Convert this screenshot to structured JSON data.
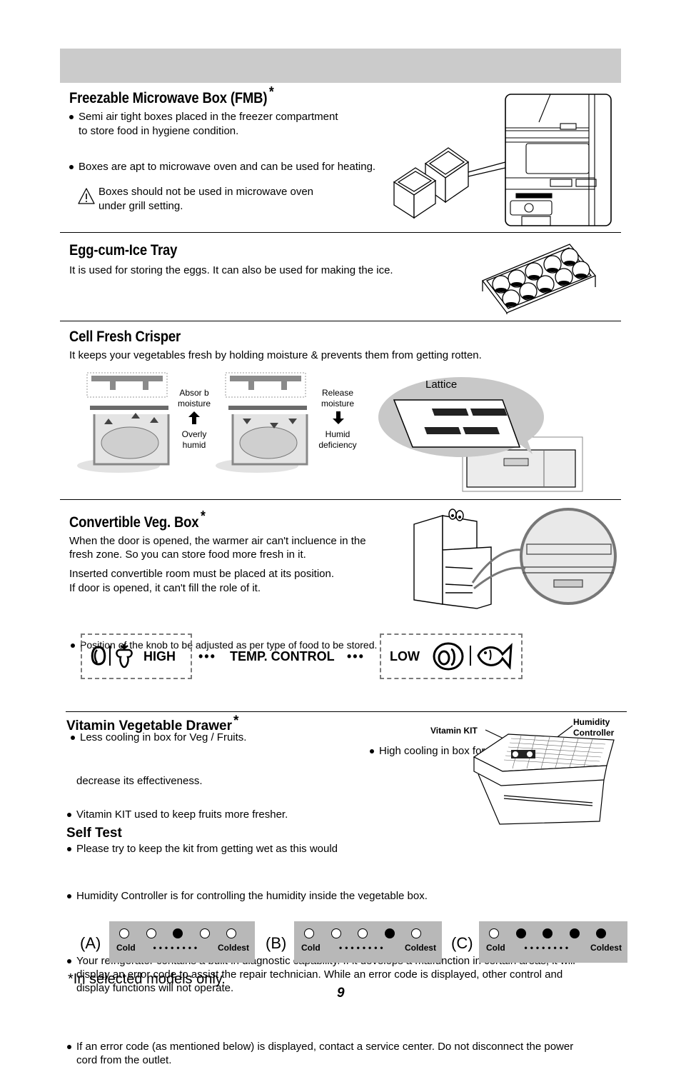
{
  "fmb": {
    "title": "Freezable Microwave Box (FMB)",
    "star": "*",
    "bullets": [
      "Semi air tight boxes placed in the freezer compartment",
      "to store food in hygiene condition.",
      "Boxes are apt to microwave oven and can be used for heating."
    ],
    "warning_line1": "Boxes should not be used in microwave oven",
    "warning_line2": "under grill setting."
  },
  "egg_tray": {
    "title": "Egg-cum-Ice Tray",
    "text": "It is used for storing the eggs. It can also be used for making the ice."
  },
  "crisper": {
    "title": "Cell Fresh Crisper",
    "text": "It keeps your vegetables fresh by holding moisture & prevents them from getting rotten.",
    "left_top1": "Absor b",
    "left_top2": "moisture",
    "left_bottom1": "Overly",
    "left_bottom2": "humid",
    "right_top1": "Release",
    "right_top2": "moisture",
    "right_bottom1": "Humid",
    "right_bottom2": "deficiency",
    "lattice_label": "Lattice"
  },
  "veg_box": {
    "title": "Convertible Veg. Box",
    "star": "*",
    "para1_line1": "When the door is opened, the warmer air can't incluence in the",
    "para1_line2": "fresh zone. So you can store food more fresh in it.",
    "para2_line1": "Inserted convertible room must be placed at its position.",
    "para2_line2": "If door is opened, it can't fill the role of it.",
    "knob_note": "Position of the knob to be adjusted as per type of food to be stored.",
    "high_label": "HIGH",
    "control_label": "TEMP. CONTROL",
    "low_label": "LOW",
    "dots": "•••",
    "high_note": "Less cooling in box for Veg / Fruits.",
    "low_note": "High cooling in box for Fish / Meat / Dairy."
  },
  "vitamin": {
    "title": "Vitamin Vegetable Drawer",
    "star": "*",
    "bullets": [
      "Vitamin KIT used to keep fruits more fresher.",
      "Please try to keep the kit from getting wet as this would",
      "decrease its effectiveness.",
      "Humidity Controller is for controlling the humidity inside the vegetable box."
    ],
    "kit_label": "Vitamin KIT",
    "humidity_label1": "Humidity",
    "humidity_label2": "Controller"
  },
  "self_test": {
    "title": "Self Test",
    "bullet1_lines": [
      "Your refrigerator contains a built in diagnostic capability. If it develops a malfunction in certain areas, it will",
      "display an error code to assist the repair technician. While an error code is displayed, other control and",
      "display functions will not operate."
    ],
    "bullet2_lines": [
      "If an error code (as mentioned below) is displayed, contact a service center. Do not disconnect the power",
      "cord from the outlet."
    ],
    "panels": [
      {
        "label": "(A)",
        "leds": [
          false,
          false,
          true,
          false,
          false
        ],
        "cold": "Cold",
        "coldest": "Coldest"
      },
      {
        "label": "(B)",
        "leds": [
          false,
          false,
          false,
          true,
          false
        ],
        "cold": "Cold",
        "coldest": "Coldest"
      },
      {
        "label": "(C)",
        "leds": [
          false,
          true,
          true,
          true,
          true
        ],
        "cold": "Cold",
        "coldest": "Coldest"
      }
    ],
    "scale_dots": "••••••••"
  },
  "footnote": "*In selected models only.",
  "page_number": "9"
}
